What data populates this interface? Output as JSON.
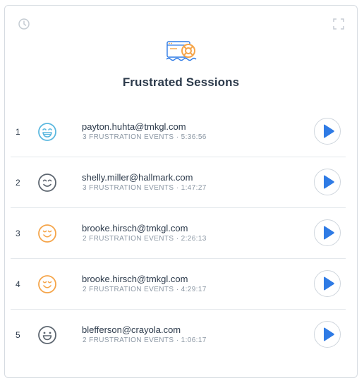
{
  "card": {
    "title": "Frustrated Sessions",
    "icons": {
      "history": "clock-icon",
      "expand": "expand-icon",
      "hero": "browser-lifebuoy-icon"
    }
  },
  "sessions": [
    {
      "rank": "1",
      "email": "payton.huhta@tmkgl.com",
      "events": "3 FRUSTRATION EVENTS",
      "duration": "5:36:56",
      "face": "laughing-face-icon",
      "face_color": "#5bb8df"
    },
    {
      "rank": "2",
      "email": "shelly.miller@hallmark.com",
      "events": "3 FRUSTRATION EVENTS",
      "duration": "1:47:27",
      "face": "smiling-face-icon",
      "face_color": "#5d6670"
    },
    {
      "rank": "3",
      "email": "brooke.hirsch@tmkgl.com",
      "events": "2 FRUSTRATION EVENTS",
      "duration": "2:26:13",
      "face": "content-face-icon",
      "face_color": "#f5a54a"
    },
    {
      "rank": "4",
      "email": "brooke.hirsch@tmkgl.com",
      "events": "2 FRUSTRATION EVENTS",
      "duration": "4:29:17",
      "face": "content-face-icon",
      "face_color": "#f5a54a"
    },
    {
      "rank": "5",
      "email": "blefferson@crayola.com",
      "events": "2 FRUSTRATION EVENTS",
      "duration": "1:06:17",
      "face": "grinning-face-icon",
      "face_color": "#5d6670"
    }
  ],
  "separator": "·",
  "colors": {
    "accent": "#2f7be5",
    "border": "#d6dbe1",
    "text": "#2c3a4b",
    "muted": "#8a96a3"
  }
}
